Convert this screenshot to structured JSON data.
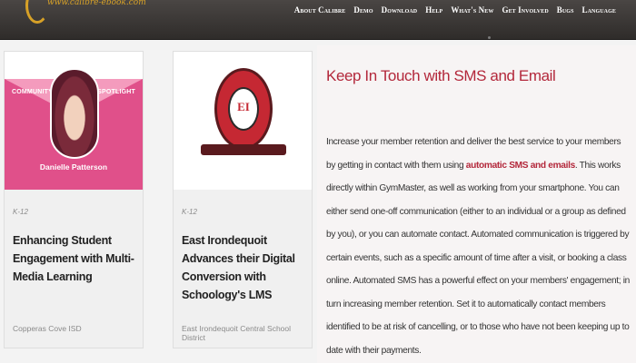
{
  "logo": {
    "text": "www.calibre-ebook.com"
  },
  "nav": [
    "About Calibre",
    "Demo",
    "Download",
    "Help",
    "What's New",
    "Get Involved",
    "Bugs",
    "Language"
  ],
  "cards": [
    {
      "image": {
        "left_label": "COMMUNITY",
        "right_label": "SPOTLIGHT",
        "person": "Danielle Patterson"
      },
      "tag": "K-12",
      "title": "Enhancing Student Engagement with Multi-Media Learning",
      "source": "Copperas Cove ISD"
    },
    {
      "image": {
        "seal_text": "EI"
      },
      "tag": "K-12",
      "title": "East Irondequoit Advances their Digital Conversion with Schoology's LMS",
      "source": "East Irondequoit Central School District"
    }
  ],
  "article": {
    "heading": "Keep In Touch with SMS and Email",
    "para_before": "Increase your member retention and deliver the best service to your members by getting in contact with them using ",
    "link_text": "automatic SMS and emails",
    "para_after": ". This works directly within GymMaster, as well as working from your smartphone. You can either send one-off communication (either to an individual or a group as defined by you), or you can automate contact. Automated communication is triggered by certain events, such as a specific amount of time after a visit, or booking a class online. Automated SMS has a powerful effect on your members' engagement; in turn increasing member retention. Set it to automatically contact members identified to be at risk of cancelling, or to those who have not been keeping up to date with their payments."
  },
  "colors": {
    "accent": "#b3283b",
    "header_bg": "#3a3634",
    "pink": "#e0508a"
  }
}
